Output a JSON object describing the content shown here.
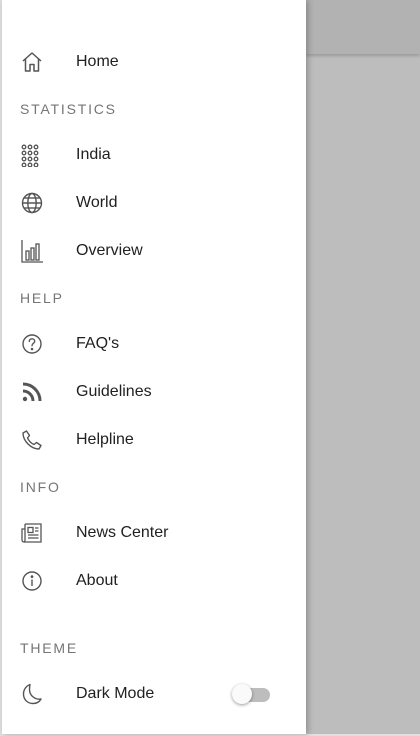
{
  "drawer": {
    "home": {
      "label": "Home",
      "icon": "home-icon"
    },
    "sections": {
      "statistics": "STATISTICS",
      "help": "HELP",
      "info": "INFO",
      "theme": "THEME"
    },
    "statistics_items": [
      {
        "label": "India",
        "icon": "apps-grid-icon"
      },
      {
        "label": "World",
        "icon": "globe-icon"
      },
      {
        "label": "Overview",
        "icon": "bar-chart-icon"
      }
    ],
    "help_items": [
      {
        "label": "FAQ's",
        "icon": "help-circle-icon"
      },
      {
        "label": "Guidelines",
        "icon": "rss-feed-icon"
      },
      {
        "label": "Helpline",
        "icon": "phone-icon"
      }
    ],
    "info_items": [
      {
        "label": "News Center",
        "icon": "newspaper-icon"
      },
      {
        "label": "About",
        "icon": "info-icon"
      }
    ],
    "theme_items": [
      {
        "label": "Dark Mode",
        "icon": "moon-icon",
        "toggle_on": false
      }
    ]
  }
}
